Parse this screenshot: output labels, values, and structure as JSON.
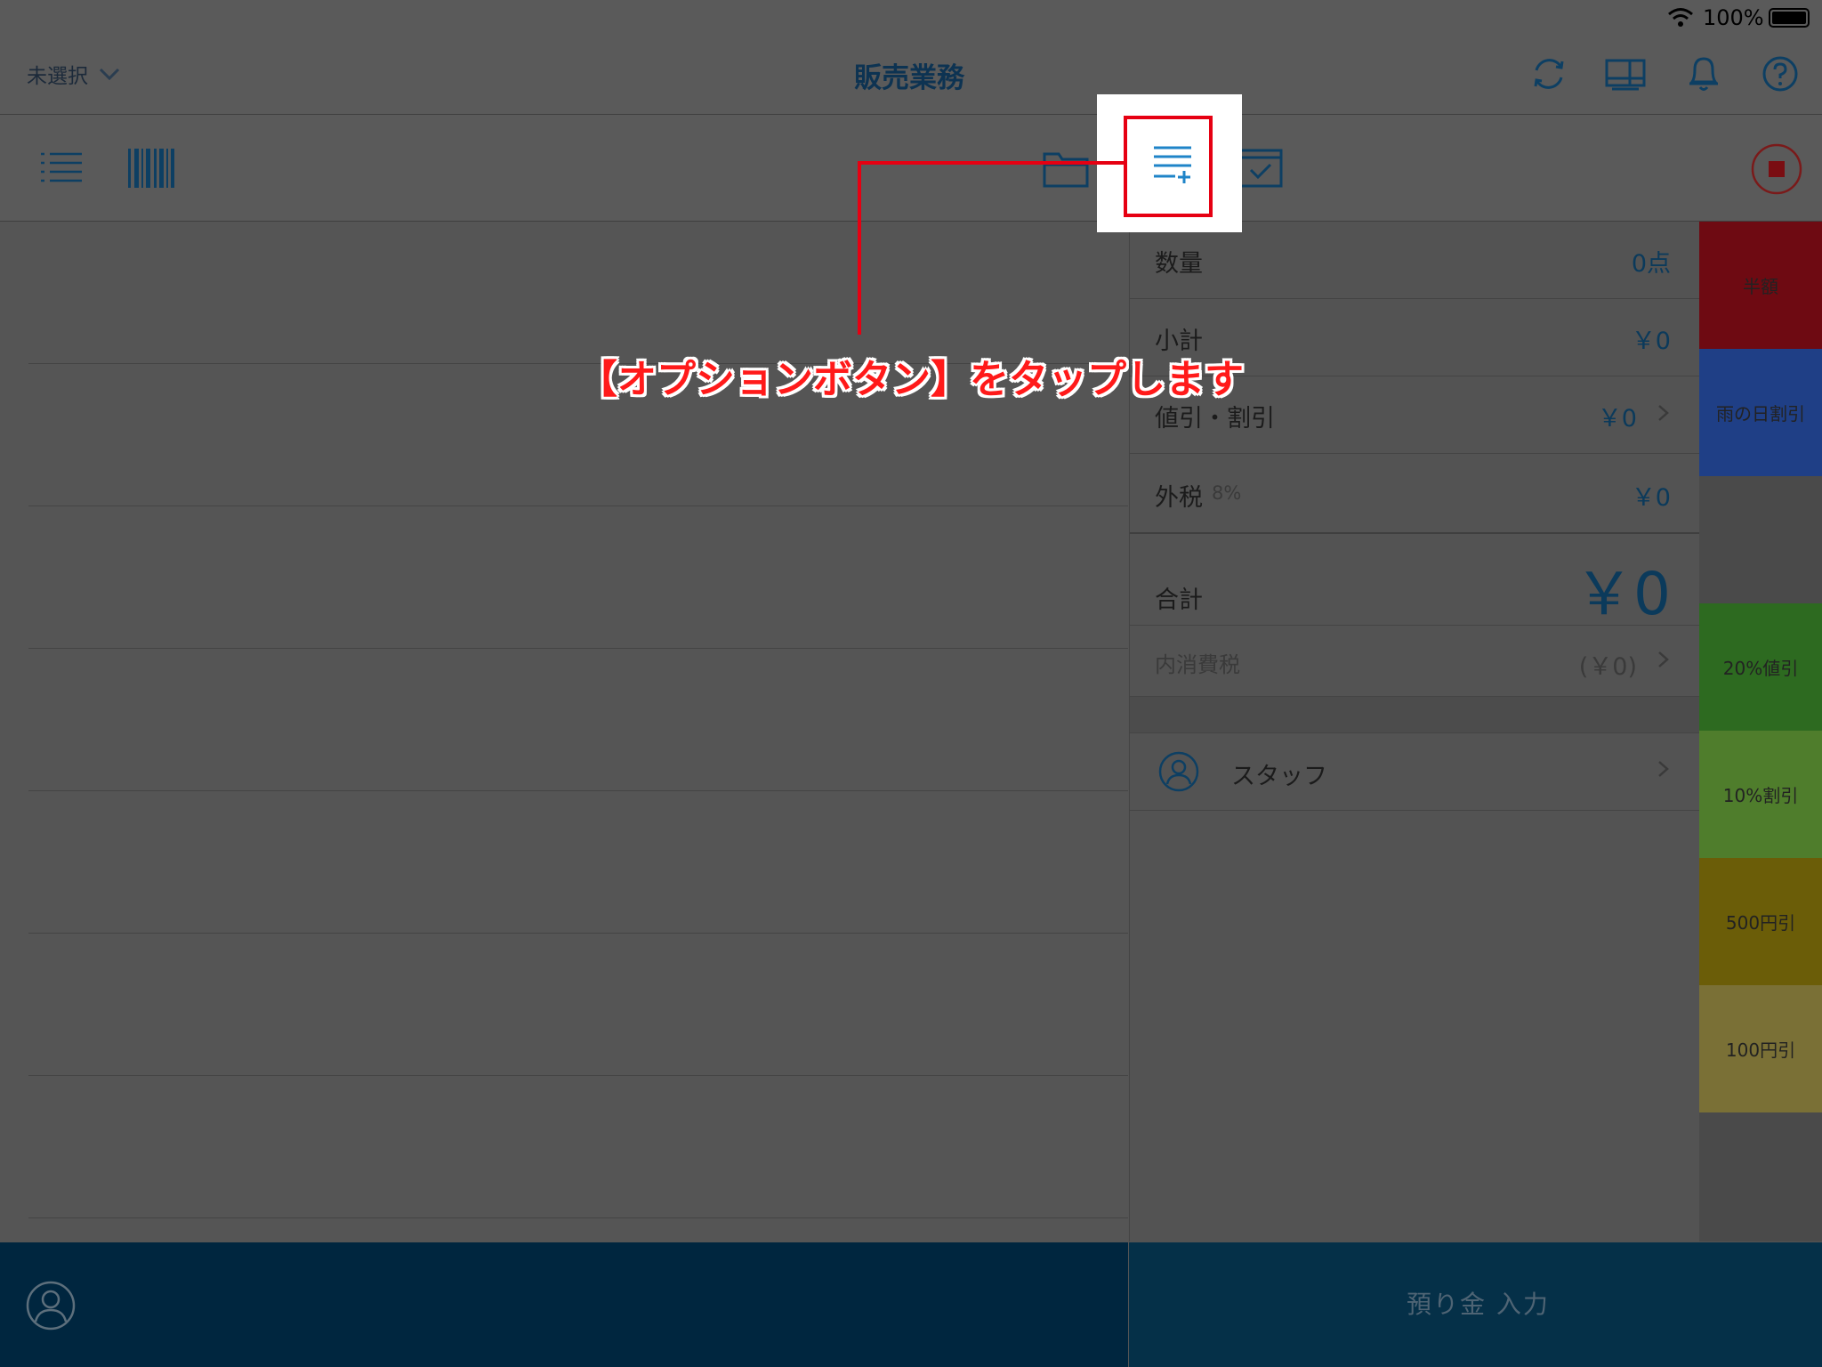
{
  "status": {
    "battery_pct": "100%"
  },
  "nav": {
    "store_select": "未選択",
    "title": "販売業務"
  },
  "summary": {
    "qty_label": "数量",
    "qty_value": "0点",
    "subtotal_label": "小計",
    "subtotal_value": "￥0",
    "discount_label": "値引・割引",
    "discount_value": "￥0",
    "tax_label": "外税",
    "tax_rate": "8%",
    "tax_value": "￥0",
    "total_label": "合計",
    "total_value": "￥0",
    "inner_tax_label": "内消費税",
    "inner_tax_value": "(￥0)",
    "staff_label": "スタッフ"
  },
  "quickkeys": [
    {
      "label": "半額",
      "color": "#6e0a12"
    },
    {
      "label": "雨の日割引",
      "color": "#1f3f86"
    },
    {
      "label": "",
      "color": "#4a4a4a"
    },
    {
      "label": "20%値引",
      "color": "#2d6a20"
    },
    {
      "label": "10%割引",
      "color": "#4f7d2c"
    },
    {
      "label": "500円引",
      "color": "#6b5d08"
    },
    {
      "label": "100円引",
      "color": "#7a7036"
    }
  ],
  "bottom": {
    "deposit_button": "預り金 入力"
  },
  "callout": {
    "text": "【オプションボタン】をタップします",
    "color": "#e60012"
  }
}
